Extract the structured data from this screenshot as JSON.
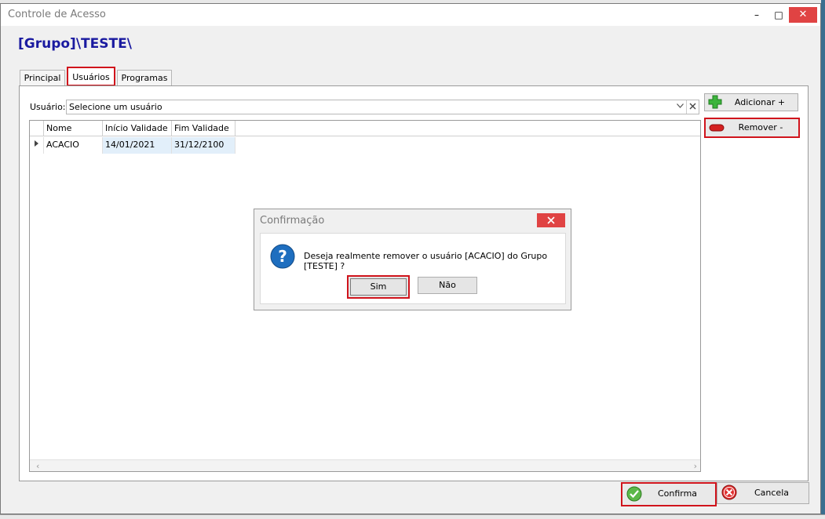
{
  "window": {
    "title": "Controle de Acesso",
    "minimize_glyph": "–",
    "maximize_glyph": "□",
    "close_glyph": "✕"
  },
  "group_title": "[Grupo]\\TESTE\\",
  "tabs": [
    {
      "label": "Principal"
    },
    {
      "label": "Usuários",
      "selected": true
    },
    {
      "label": "Programas"
    }
  ],
  "user_filter": {
    "label": "Usuário:",
    "value": "Selecione um usuário"
  },
  "buttons": {
    "add": "Adicionar +",
    "remove": "Remover -",
    "confirm": "Confirma",
    "cancel": "Cancela"
  },
  "grid": {
    "columns": [
      "Nome",
      "Início Validade",
      "Fim Validade"
    ],
    "rows": [
      {
        "nome": "ACACIO",
        "inicio": "14/01/2021",
        "fim": "31/12/2100"
      }
    ]
  },
  "dialog": {
    "title": "Confirmação",
    "message": "Deseja realmente remover o usuário [ACACIO] do Grupo [TESTE] ?",
    "yes": "Sim",
    "no": "Não"
  },
  "colors": {
    "accent_title": "#1a1aa0",
    "highlight_red": "#d0141c",
    "close_red": "#e04343",
    "selected_cell": "#e2effa"
  },
  "icons": {
    "add": "plus-icon",
    "remove": "minus-icon",
    "confirm": "checkmark-icon",
    "cancel": "cancel-icon",
    "dialog": "question-icon"
  }
}
